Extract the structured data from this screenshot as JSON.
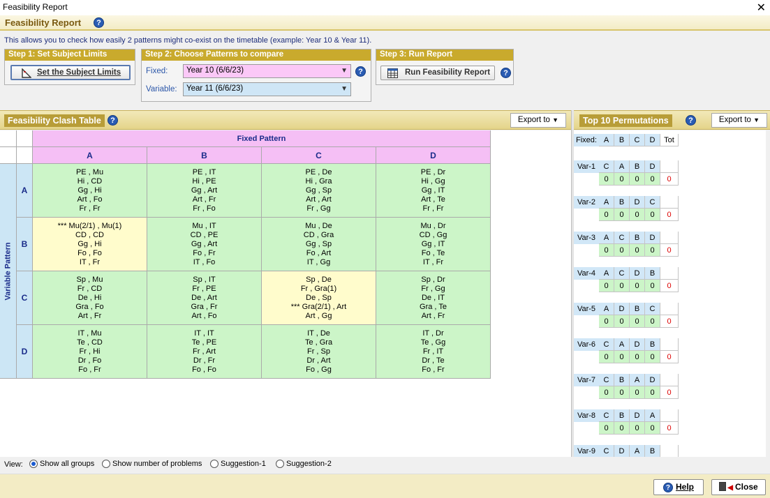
{
  "window": {
    "title": "Feasibility Report",
    "close_glyph": "✕"
  },
  "header": {
    "title": "Feasibility Report"
  },
  "description": "This allows you to check how easily 2 patterns might co-exist on the timetable (example: Year 10 & Year 11).",
  "step1": {
    "title": "Step 1: Set Subject Limits",
    "button": "Set the Subject Limits"
  },
  "step2": {
    "title": "Step 2: Choose Patterns to compare",
    "fixed_label": "Fixed:",
    "fixed_value": "Year 10 (6/6/23)",
    "variable_label": "Variable:",
    "variable_value": "Year 11 (6/6/23)"
  },
  "step3": {
    "title": "Step 3: Run Report",
    "button": "Run Feasibility Report"
  },
  "clash": {
    "title": "Feasibility Clash Table",
    "export": "Export to",
    "fixed_pattern": "Fixed Pattern",
    "variable_pattern": "Variable Pattern",
    "col_headers": [
      "A",
      "B",
      "C",
      "D"
    ],
    "row_headers": [
      "A",
      "B",
      "C",
      "D"
    ],
    "rows": [
      [
        [
          "PE , Mu",
          "Hi , CD",
          "Gg , Hi",
          "Art , Fo",
          "Fr , Fr"
        ],
        [
          "PE , IT",
          "Hi , PE",
          "Gg , Art",
          "Art , Fr",
          "Fr , Fo"
        ],
        [
          "PE , De",
          "Hi , Gra",
          "Gg , Sp",
          "Art , Art",
          "Fr , Gg"
        ],
        [
          "PE , Dr",
          "Hi , Gg",
          "Gg , IT",
          "Art , Te",
          "Fr , Fr"
        ]
      ],
      [
        [
          "*** Mu(2/1) , Mu(1)",
          "CD , CD",
          "Gg , Hi",
          "Fo , Fo",
          "IT , Fr"
        ],
        [
          "Mu , IT",
          "CD , PE",
          "Gg , Art",
          "Fo , Fr",
          "IT , Fo"
        ],
        [
          "Mu , De",
          "CD , Gra",
          "Gg , Sp",
          "Fo , Art",
          "IT , Gg"
        ],
        [
          "Mu , Dr",
          "CD , Gg",
          "Gg , IT",
          "Fo , Te",
          "IT , Fr"
        ]
      ],
      [
        [
          "Sp , Mu",
          "Fr , CD",
          "De , Hi",
          "Gra , Fo",
          "Art , Fr"
        ],
        [
          "Sp , IT",
          "Fr , PE",
          "De , Art",
          "Gra , Fr",
          "Art , Fo"
        ],
        [
          "Sp , De",
          "Fr , Gra(1)",
          "De , Sp",
          "*** Gra(2/1) , Art",
          "Art , Gg"
        ],
        [
          "Sp , Dr",
          "Fr , Gg",
          "De , IT",
          "Gra , Te",
          "Art , Fr"
        ]
      ],
      [
        [
          "IT , Mu",
          "Te , CD",
          "Fr , Hi",
          "Dr , Fo",
          "Fo , Fr"
        ],
        [
          "IT , IT",
          "Te , PE",
          "Fr , Art",
          "Dr , Fr",
          "Fo , Fo"
        ],
        [
          "IT , De",
          "Te , Gra",
          "Fr , Sp",
          "Dr , Art",
          "Fo , Gg"
        ],
        [
          "IT , Dr",
          "Te , Gg",
          "Fr , IT",
          "Dr , Te",
          "Fo , Fr"
        ]
      ]
    ],
    "highlight": [
      [
        1,
        0
      ],
      [
        2,
        2
      ]
    ]
  },
  "perms": {
    "title": "Top 10 Permutations",
    "export": "Export to",
    "fixed_label": "Fixed:",
    "fixed_cols": [
      "A",
      "B",
      "C",
      "D"
    ],
    "tot_label": "Tot",
    "rows": [
      {
        "label": "Var-1",
        "order": [
          "C",
          "A",
          "B",
          "D"
        ],
        "values": [
          "0",
          "0",
          "0",
          "0"
        ],
        "tot": "0"
      },
      {
        "label": "Var-2",
        "order": [
          "A",
          "B",
          "D",
          "C"
        ],
        "values": [
          "0",
          "0",
          "0",
          "0"
        ],
        "tot": "0"
      },
      {
        "label": "Var-3",
        "order": [
          "A",
          "C",
          "B",
          "D"
        ],
        "values": [
          "0",
          "0",
          "0",
          "0"
        ],
        "tot": "0"
      },
      {
        "label": "Var-4",
        "order": [
          "A",
          "C",
          "D",
          "B"
        ],
        "values": [
          "0",
          "0",
          "0",
          "0"
        ],
        "tot": "0"
      },
      {
        "label": "Var-5",
        "order": [
          "A",
          "D",
          "B",
          "C"
        ],
        "values": [
          "0",
          "0",
          "0",
          "0"
        ],
        "tot": "0"
      },
      {
        "label": "Var-6",
        "order": [
          "C",
          "A",
          "D",
          "B"
        ],
        "values": [
          "0",
          "0",
          "0",
          "0"
        ],
        "tot": "0"
      },
      {
        "label": "Var-7",
        "order": [
          "C",
          "B",
          "A",
          "D"
        ],
        "values": [
          "0",
          "0",
          "0",
          "0"
        ],
        "tot": "0"
      },
      {
        "label": "Var-8",
        "order": [
          "C",
          "B",
          "D",
          "A"
        ],
        "values": [
          "0",
          "0",
          "0",
          "0"
        ],
        "tot": "0"
      },
      {
        "label": "Var-9",
        "order": [
          "C",
          "D",
          "A",
          "B"
        ],
        "values": [],
        "tot": ""
      }
    ]
  },
  "footer": {
    "view_label": "View:",
    "options": [
      "Show all groups",
      "Show number of problems",
      "Suggestion-1",
      "Suggestion-2"
    ],
    "selected": 0,
    "help": "Help",
    "close": "Close"
  }
}
